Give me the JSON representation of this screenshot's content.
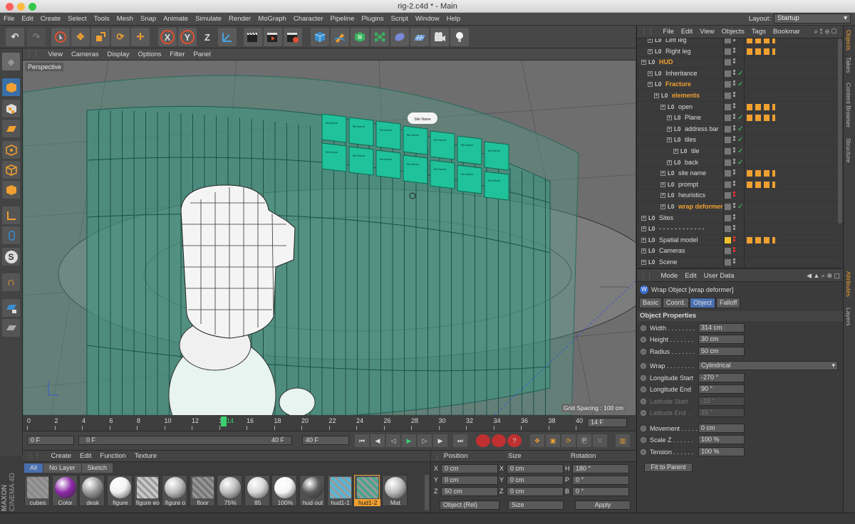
{
  "window": {
    "title": "rig-2.c4d * - Main"
  },
  "menubar": {
    "items": [
      "File",
      "Edit",
      "Create",
      "Select",
      "Tools",
      "Mesh",
      "Snap",
      "Animate",
      "Simulate",
      "Render",
      "MoGraph",
      "Character",
      "Pipeline",
      "Plugins",
      "Script",
      "Window",
      "Help"
    ]
  },
  "layout": {
    "label": "Layout:",
    "value": "Startup"
  },
  "toolbar": {
    "x_label": "X",
    "y_label": "Y",
    "z_label": "Z"
  },
  "viewport": {
    "menu": [
      "View",
      "Cameras",
      "Display",
      "Options",
      "Filter",
      "Panel"
    ],
    "name": "Perspective",
    "grid_spacing": "Grid Spacing : 100 cm",
    "card_label": "Tile Name",
    "pill_label": "Site Name"
  },
  "timeline": {
    "ticks": [
      "0",
      "2",
      "4",
      "6",
      "8",
      "10",
      "12",
      "14",
      "16",
      "18",
      "20",
      "22",
      "24",
      "26",
      "28",
      "30",
      "32",
      "34",
      "36",
      "38",
      "40"
    ],
    "current_frame": "14 F",
    "playhead": "14",
    "start_field": "0 F",
    "range_start": "0 F",
    "range_end": "40 F",
    "end_field": "40 F"
  },
  "materials": {
    "menu": [
      "Create",
      "Edit",
      "Function",
      "Texture"
    ],
    "filters": [
      "All",
      "No Layer",
      "Sketch"
    ],
    "items": [
      {
        "name": "cubes",
        "color": "#8a8a8a"
      },
      {
        "name": "Color",
        "color": "#8e2aa8"
      },
      {
        "name": "desk",
        "color": "#9a9a9a"
      },
      {
        "name": "figure",
        "color": "#f2f2f2"
      },
      {
        "name": "figure eo",
        "color": "#c8c8c8"
      },
      {
        "name": "figure o",
        "color": "#bcbcbc"
      },
      {
        "name": "floor",
        "color": "#777777"
      },
      {
        "name": "75%",
        "color": "#bdbdbd"
      },
      {
        "name": "85",
        "color": "#d6d6d6"
      },
      {
        "name": "100%",
        "color": "#f6f6f6"
      },
      {
        "name": "hud out",
        "color": "#5b5b5b"
      },
      {
        "name": "hud1-1",
        "color": "#58b6d4"
      },
      {
        "name": "hud1-2",
        "color": "#4aa38a"
      },
      {
        "name": "Mat",
        "color": "#bdbdbd"
      }
    ],
    "brand_line1": "MAXON",
    "brand_line2": "CINEMA 4D"
  },
  "coords": {
    "headers": [
      "Position",
      "Size",
      "Rotation"
    ],
    "rows": [
      {
        "a": "X",
        "av": "0 cm",
        "b": "X",
        "bv": "0 cm",
        "c": "H",
        "cv": "180 °"
      },
      {
        "a": "Y",
        "av": "0 cm",
        "b": "Y",
        "bv": "0 cm",
        "c": "P",
        "cv": "0 °"
      },
      {
        "a": "Z",
        "av": "50 cm",
        "b": "Z",
        "bv": "0 cm",
        "c": "B",
        "cv": "0 °"
      }
    ],
    "mode": "Object (Rel)",
    "size_mode": "Size",
    "apply": "Apply"
  },
  "objects": {
    "menu": [
      "File",
      "Edit",
      "View",
      "Objects",
      "Tags",
      "Bookmar"
    ],
    "rows": [
      {
        "name": "Left leg",
        "indent": 1,
        "color": "#dddddd",
        "status": "",
        "tags": true
      },
      {
        "name": "Right leg",
        "indent": 1,
        "color": "#dddddd",
        "status": "",
        "tags": true
      },
      {
        "name": "HUD",
        "indent": 0,
        "color": "#f0a030",
        "status": "",
        "tags": false
      },
      {
        "name": "Inheritance",
        "indent": 1,
        "color": "#dddddd",
        "status": "check",
        "tags": false
      },
      {
        "name": "Fracture",
        "indent": 1,
        "color": "#f0a030",
        "status": "check",
        "tags": false
      },
      {
        "name": "elements",
        "indent": 2,
        "color": "#f0a030",
        "status": "",
        "tags": false
      },
      {
        "name": "open",
        "indent": 3,
        "color": "#dddddd",
        "status": "",
        "tags": true
      },
      {
        "name": "Plane",
        "indent": 4,
        "color": "#dddddd",
        "status": "check",
        "tags": true
      },
      {
        "name": "address bar",
        "indent": 4,
        "color": "#dddddd",
        "status": "check",
        "tags": false
      },
      {
        "name": "tiles",
        "indent": 4,
        "color": "#dddddd",
        "status": "check",
        "tags": false
      },
      {
        "name": "tile",
        "indent": 5,
        "color": "#dddddd",
        "status": "check",
        "tags": false
      },
      {
        "name": "back",
        "indent": 4,
        "color": "#dddddd",
        "status": "check",
        "tags": false
      },
      {
        "name": "site name",
        "indent": 3,
        "color": "#dddddd",
        "status": "",
        "tags": true
      },
      {
        "name": "prompt",
        "indent": 3,
        "color": "#dddddd",
        "status": "",
        "tags": true
      },
      {
        "name": "heuristics",
        "indent": 3,
        "color": "#dddddd",
        "status": "red",
        "tags": false
      },
      {
        "name": "wrap deformer",
        "indent": 3,
        "color": "#f0a030",
        "status": "check",
        "tags": false
      },
      {
        "name": "Sites",
        "indent": 0,
        "color": "#dddddd",
        "status": "",
        "tags": false
      },
      {
        "name": "- - - - - - - - - - - -",
        "indent": 0,
        "color": "#dddddd",
        "status": "",
        "tags": false
      },
      {
        "name": "Spatial model",
        "indent": 0,
        "color": "#dddddd",
        "status": "red",
        "tags": true
      },
      {
        "name": "Cameras",
        "indent": 0,
        "color": "#dddddd",
        "status": "red",
        "tags": false
      },
      {
        "name": "Scene",
        "indent": 0,
        "color": "#dddddd",
        "status": "",
        "tags": false
      }
    ]
  },
  "attributes": {
    "menu": [
      "Mode",
      "Edit",
      "User Data"
    ],
    "object_title": "Wrap Object [wrap deformer]",
    "tabs": [
      "Basic",
      "Coord.",
      "Object",
      "Falloff"
    ],
    "active_tab": "Object",
    "section": "Object Properties",
    "props": [
      {
        "label": "Width . . . . . . . .",
        "value": "314 cm",
        "enabled": true
      },
      {
        "label": "Height . . . . . . .",
        "value": "30 cm",
        "enabled": true
      },
      {
        "label": "Radius . . . . . . .",
        "value": "50 cm",
        "enabled": true
      }
    ],
    "wrap_label": "Wrap . . . . . . . .",
    "wrap_value": "Cylindrical",
    "props2": [
      {
        "label": "Longitude Start",
        "value": "-270 °",
        "enabled": true
      },
      {
        "label": "Longitude End",
        "value": "90 °",
        "enabled": true
      },
      {
        "label": "Latitude Start",
        "value": "-15 °",
        "enabled": false
      },
      {
        "label": "Latitude End . .",
        "value": "15 °",
        "enabled": false
      }
    ],
    "props3": [
      {
        "label": "Movement . . . . .",
        "value": "0 cm",
        "enabled": true
      },
      {
        "label": "Scale Z . . . . . .",
        "value": "100 %",
        "enabled": true
      },
      {
        "label": "Tension . . . . . .",
        "value": "100 %",
        "enabled": true
      }
    ],
    "fit_button": "Fit to Parent"
  },
  "sidetabs": {
    "right_top": [
      "Objects",
      "Takes",
      "Content Browser",
      "Structure"
    ],
    "right_bottom": [
      "Attributes",
      "Layers"
    ]
  }
}
